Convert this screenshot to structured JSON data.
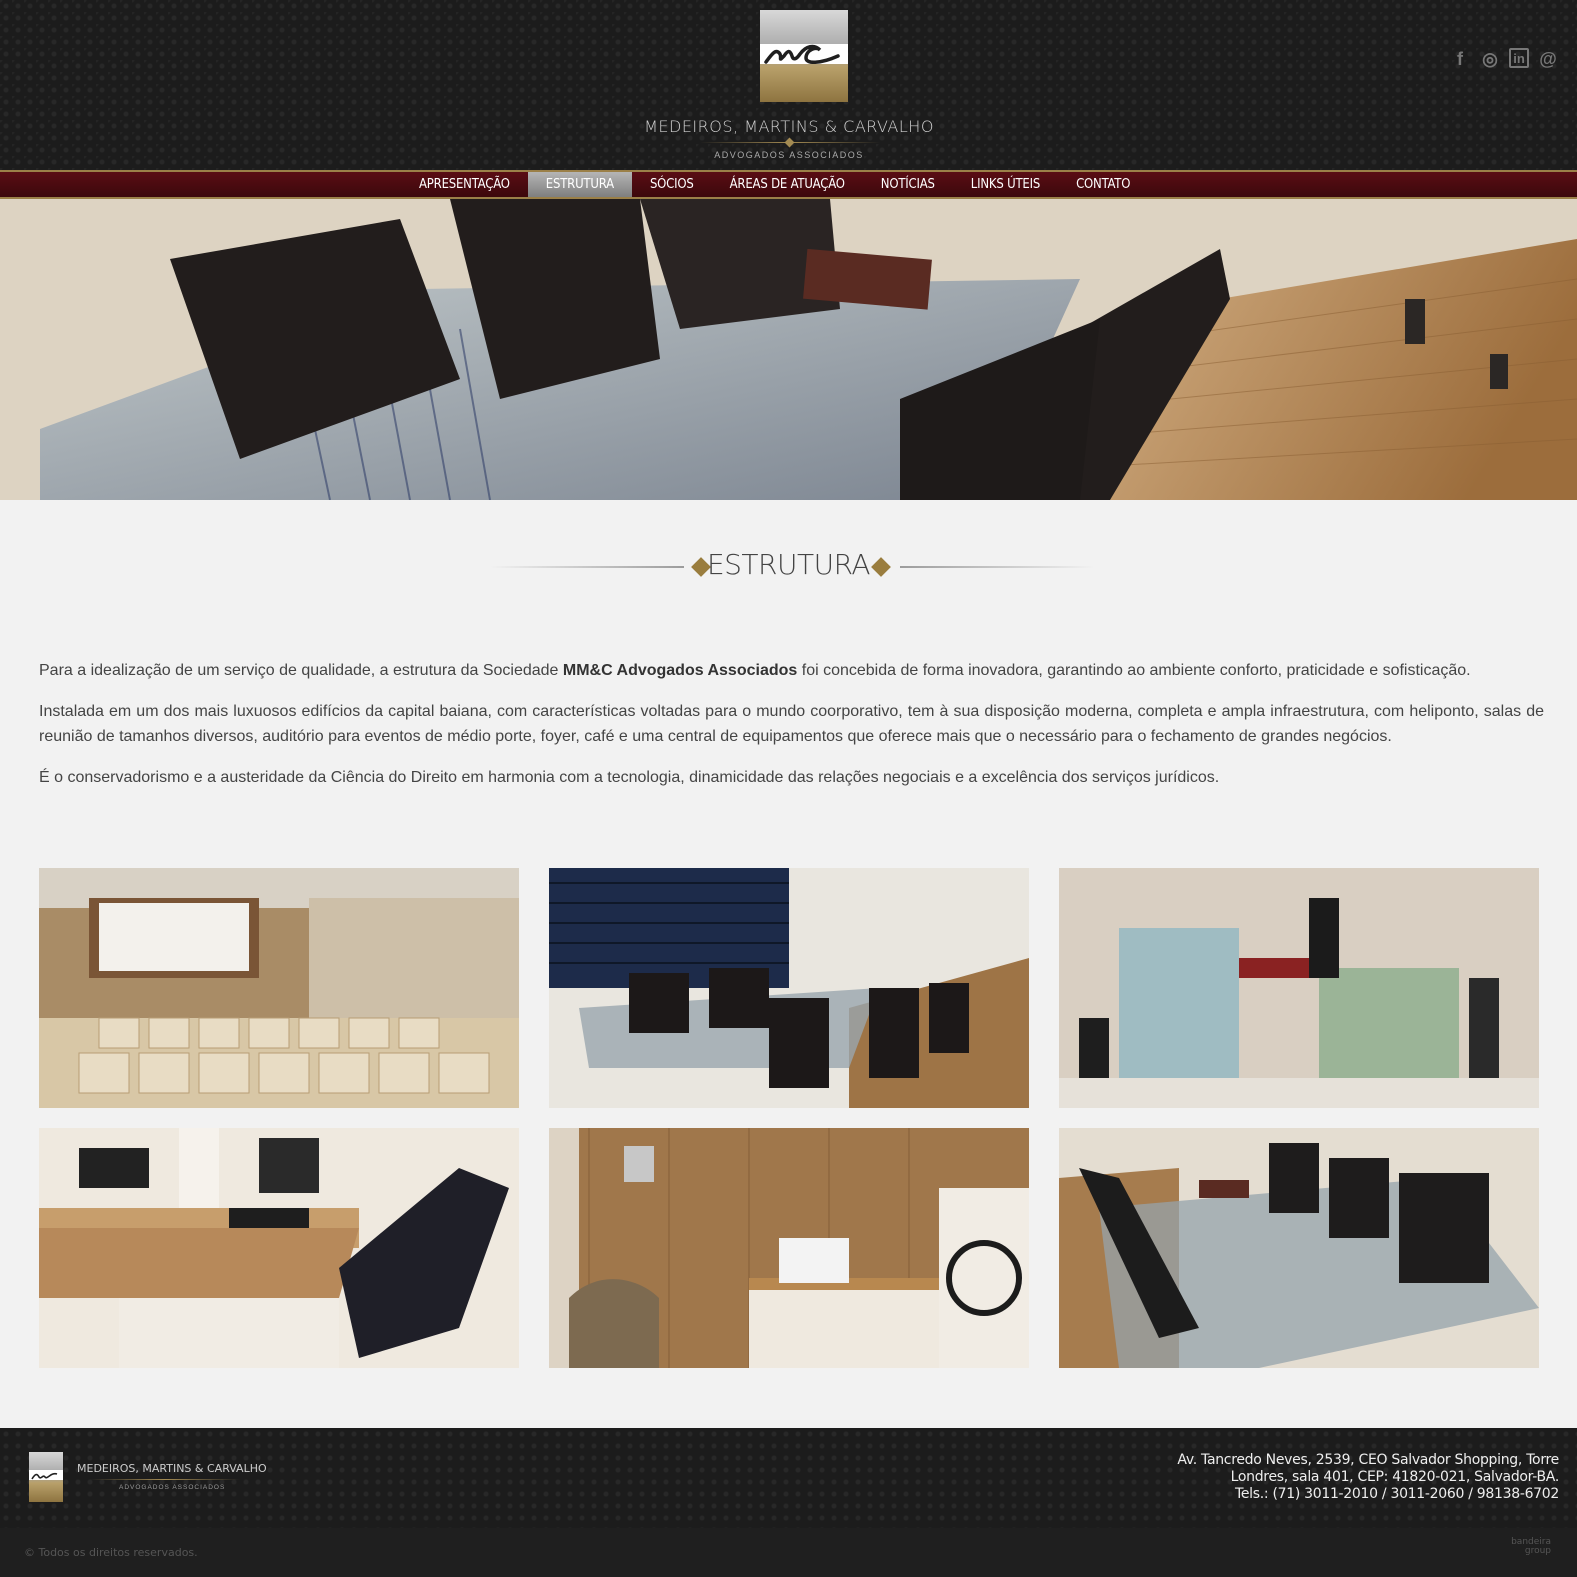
{
  "header": {
    "firm_name": "MEDEIROS, MARTINS & CARVALHO",
    "firm_subtitle": "ADVOGADOS ASSOCIADOS",
    "social": [
      {
        "name": "facebook-icon",
        "glyph": "f"
      },
      {
        "name": "instagram-icon",
        "glyph": "◎"
      },
      {
        "name": "linkedin-icon",
        "glyph": "in"
      },
      {
        "name": "email-icon",
        "glyph": "@"
      }
    ]
  },
  "nav": {
    "items": [
      {
        "label": "APRESENTAÇÃO",
        "active": false
      },
      {
        "label": "ESTRUTURA",
        "active": true
      },
      {
        "label": "SÓCIOS",
        "active": false
      },
      {
        "label": "ÁREAS DE ATUAÇÃO",
        "active": false
      },
      {
        "label": "NOTÍCIAS",
        "active": false
      },
      {
        "label": "LINKS ÚTEIS",
        "active": false
      },
      {
        "label": "CONTATO",
        "active": false
      }
    ]
  },
  "section": {
    "title": "ESTRUTURA",
    "paragraphs": [
      {
        "before": "Para a idealização de um serviço de qualidade, a estrutura da Sociedade ",
        "bold": "MM&C Advogados Associados",
        "after": " foi concebida de forma inovadora, garantindo ao ambiente conforto, praticidade e sofisticação."
      },
      {
        "before": "Instalada em um dos mais luxuosos edifícios da capital baiana, com características voltadas para o mundo coorporativo, tem à sua disposição moderna, completa e ampla infraestrutura, com heliponto, salas de reunião de tamanhos diversos, auditório para eventos de médio porte, foyer, café e uma central de equipamentos que oferece mais que o necessário para o fechamento de grandes negócios.",
        "bold": "",
        "after": ""
      },
      {
        "before": "É o conservadorismo e a austeridade da Ciência do Direito em harmonia com a tecnologia, dinamicidade das relações negociais e a excelência dos serviços jurídicos.",
        "bold": "",
        "after": ""
      }
    ]
  },
  "gallery": [
    {
      "name": "photo-auditorium"
    },
    {
      "name": "photo-meeting-room"
    },
    {
      "name": "photo-lobby"
    },
    {
      "name": "photo-office-desk"
    },
    {
      "name": "photo-reception"
    },
    {
      "name": "photo-glass-table"
    }
  ],
  "footer": {
    "firm_name": "MEDEIROS, MARTINS & CARVALHO",
    "firm_subtitle": "ADVOGADOS ASSOCIADOS",
    "address_lines": [
      "Av. Tancredo Neves, 2539, CEO Salvador Shopping, Torre",
      "Londres, sala 401, CEP: 41820-021, Salvador-BA.",
      "Tels.: (71) 3011-2010 / 3011-2060 / 98138-6702"
    ],
    "copyright": "© Todos os direitos reservados.",
    "credit_line1": "bandeira",
    "credit_line2": "group"
  }
}
